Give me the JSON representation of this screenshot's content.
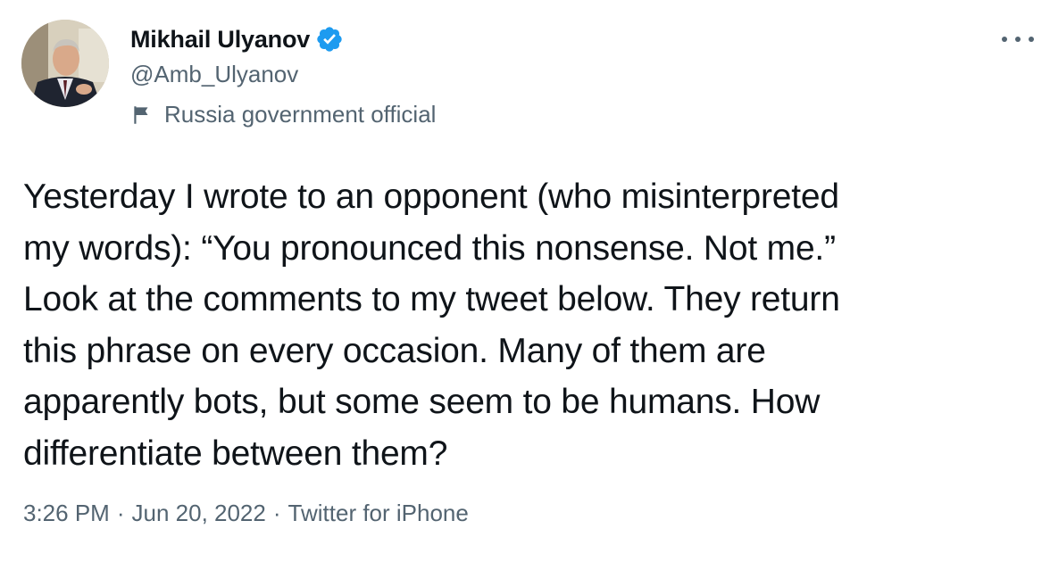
{
  "author": {
    "display_name": "Mikhail Ulyanov",
    "handle": "@Amb_Ulyanov",
    "label": "Russia government official",
    "verified": true
  },
  "icons": {
    "verified": "verified-badge-icon",
    "label": "flag-icon",
    "more": "more-icon"
  },
  "colors": {
    "verified_blue": "#1d9bf0",
    "secondary_text": "#536471",
    "primary_text": "#0f1419"
  },
  "tweet": {
    "text": "Yesterday I wrote to an opponent (who misinterpreted\nmy words): “You pronounced this nonsense. Not me.”\nLook at the comments to my tweet below. They return\nthis phrase on every occasion. Many of them are\napparently bots, but some seem to be humans. How\ndifferentiate between them?",
    "time": "3:26 PM",
    "date": "Jun 20, 2022",
    "source": "Twitter for iPhone",
    "separator": "·"
  }
}
